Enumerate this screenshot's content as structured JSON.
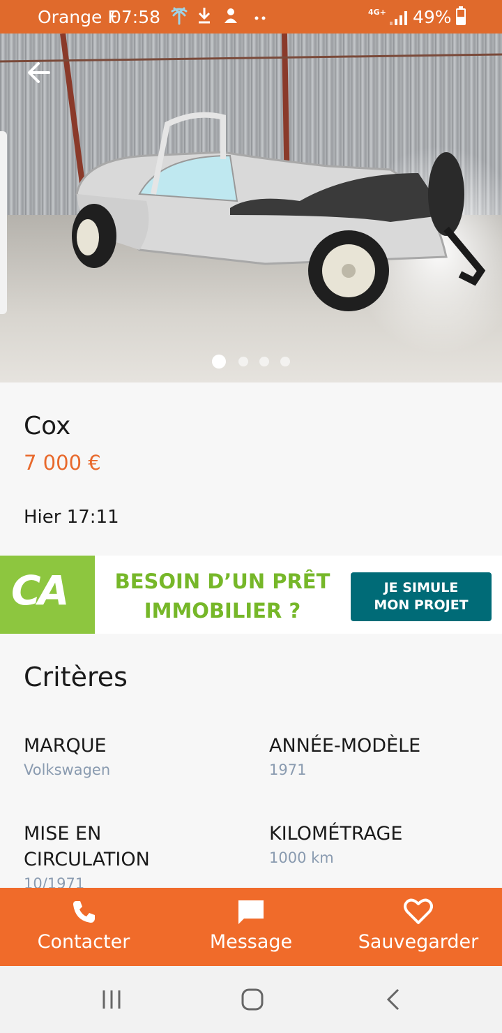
{
  "status_bar": {
    "carrier": "Orange F",
    "time": "07:58",
    "network": "4G+",
    "battery_percent": "49%",
    "battery_level": 0.49,
    "icons": [
      "palm-tree-icon",
      "download-icon",
      "notification-icon",
      "more-dots-icon",
      "signal-icon",
      "battery-icon"
    ]
  },
  "gallery": {
    "image_count": 4,
    "current_index": 0
  },
  "listing": {
    "title": "Cox",
    "price": "7 000 €",
    "date": "Hier 17:11"
  },
  "ad": {
    "logo": "CA",
    "headline_line1": "BESOIN D’UN PRÊT",
    "headline_line2": "IMMOBILIER ?",
    "cta_line1": "JE SIMULE",
    "cta_line2": "MON PROJET"
  },
  "criteria": {
    "title": "Critères",
    "items": [
      {
        "label": "MARQUE",
        "value": "Volkswagen"
      },
      {
        "label": "ANNÉE-MODÈLE",
        "value": "1971"
      },
      {
        "label": "MISE EN CIRCULATION",
        "value": "10/1971"
      },
      {
        "label": "KILOMÉTRAGE",
        "value": "1000 km"
      }
    ]
  },
  "actions": {
    "contact": "Contacter",
    "message": "Message",
    "save": "Sauvegarder"
  },
  "colors": {
    "status_bar": "#e06a2c",
    "accent": "#f06b2a",
    "price": "#e8692c",
    "criteria_value": "#8a9bb0",
    "ad_green": "#8dc63f",
    "ad_button": "#006b77"
  },
  "nav": {
    "icons": [
      "recent-apps-icon",
      "home-icon",
      "back-nav-icon"
    ]
  }
}
